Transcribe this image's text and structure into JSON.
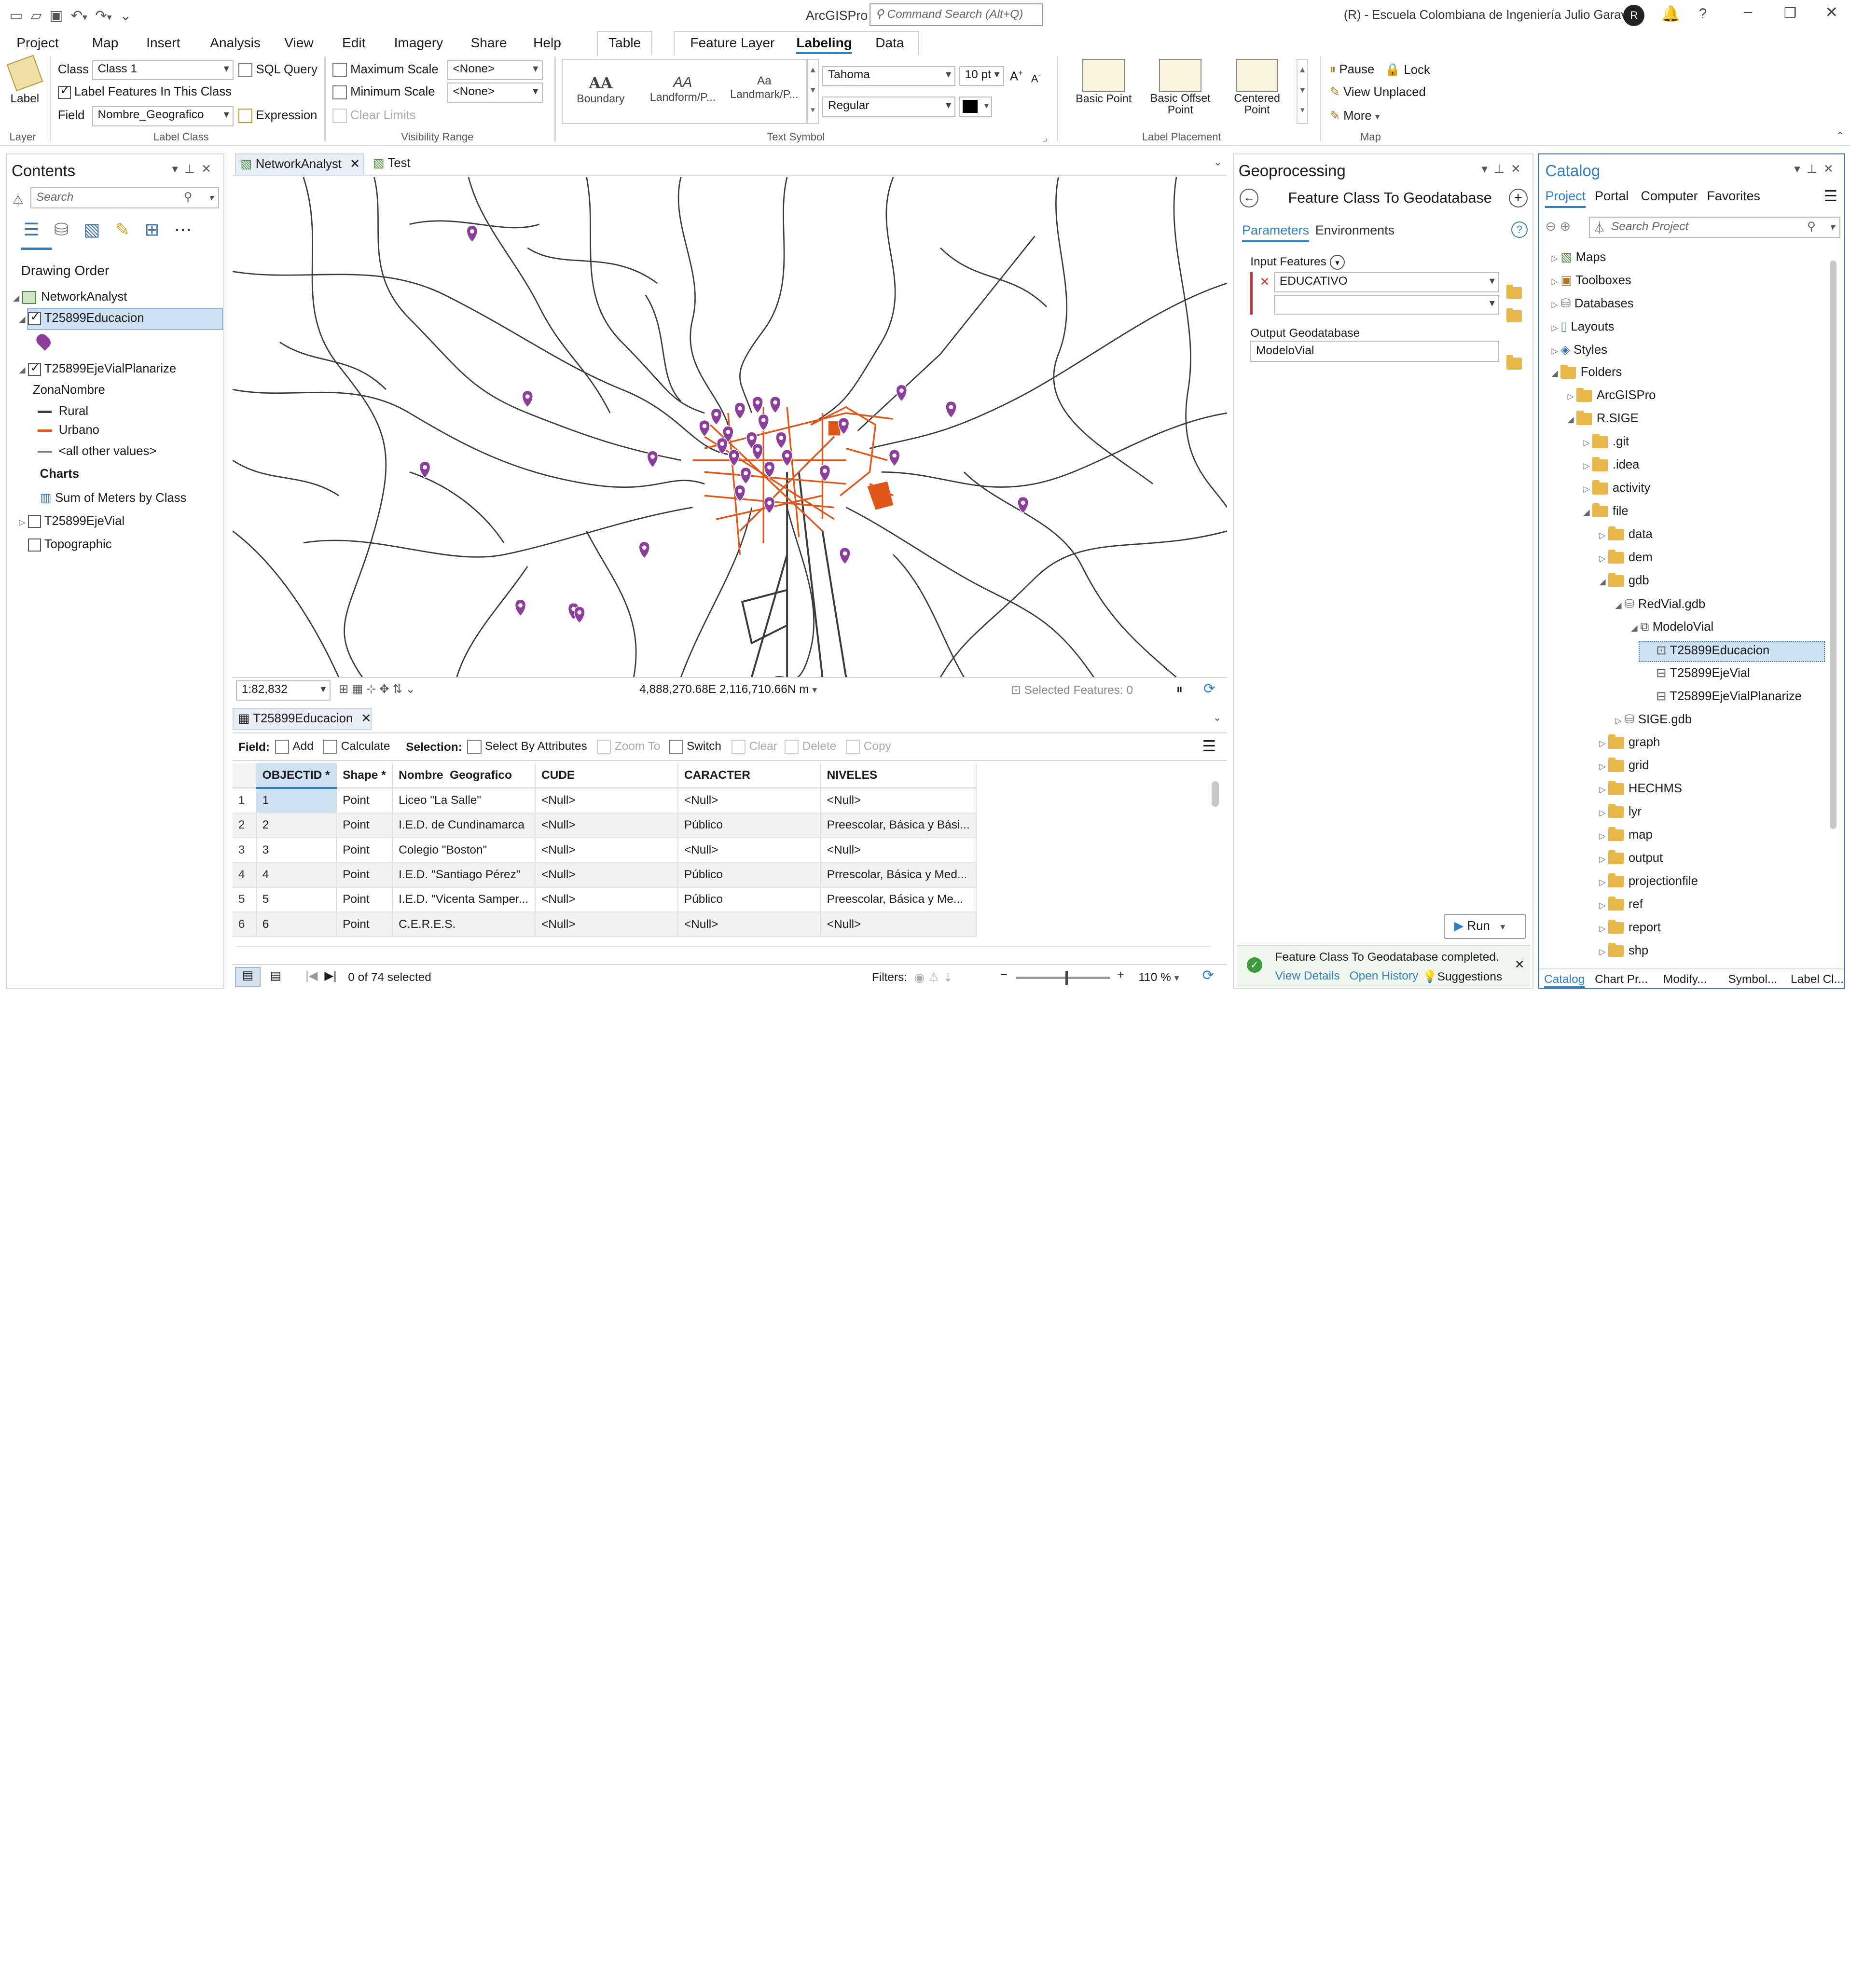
{
  "app": {
    "title": "ArcGISPro",
    "search_placeholder": "Command Search (Alt+Q)",
    "user": "(R) - Escuela Colombiana de Ingeniería Julio Garavito",
    "user_initial": "R"
  },
  "ribbon": {
    "tabs": [
      "Project",
      "Map",
      "Insert",
      "Analysis",
      "View",
      "Edit",
      "Imagery",
      "Share",
      "Help"
    ],
    "context_tabs": {
      "table": "Table",
      "feature_layer": "Feature Layer",
      "labeling": "Labeling",
      "data": "Data"
    },
    "layer_group": {
      "label_btn": "Label",
      "group": "Layer"
    },
    "label_class": {
      "class_lbl": "Class",
      "class_val": "Class 1",
      "sql": "SQL Query",
      "label_features": "Label Features In This Class",
      "field_lbl": "Field",
      "field_val": "Nombre_Geografico",
      "expression": "Expression",
      "group": "Label Class"
    },
    "visibility": {
      "max": "Maximum Scale",
      "min": "Minimum Scale",
      "max_val": "<None>",
      "min_val": "<None>",
      "clear": "Clear Limits",
      "group": "Visibility Range"
    },
    "text_symbol": {
      "s1": "Boundary",
      "s2": "Landform/P...",
      "s3": "Landmark/P...",
      "font": "Tahoma",
      "size": "10 pt",
      "style": "Regular",
      "group": "Text Symbol"
    },
    "placement": {
      "p1": "Basic Point",
      "p2": "Basic Offset Point",
      "p3": "Centered Point",
      "group": "Label Placement"
    },
    "map_group": {
      "pause": "Pause",
      "lock": "Lock",
      "unplaced": "View Unplaced",
      "more": "More",
      "group": "Map"
    }
  },
  "contents": {
    "title": "Contents",
    "search": "Search",
    "drawing_order": "Drawing Order",
    "map": "NetworkAnalyst",
    "layers": {
      "edu": "T25899Educacion",
      "eje_plan": "T25899EjeVialPlanarize",
      "zona": "ZonaNombre",
      "rural": "Rural",
      "urbano": "Urbano",
      "other": "<all other values>",
      "charts": "Charts",
      "sum": "Sum of Meters by Class",
      "eje": "T25899EjeVial",
      "topo": "Topographic"
    }
  },
  "map_view": {
    "tabs": [
      "NetworkAnalyst",
      "Test"
    ],
    "scale": "1:82,832",
    "coords": "4,888,270.68E 2,116,710.66N m",
    "selected": "Selected Features: 0",
    "colors": {
      "urban": "#e0571a",
      "road": "#3a3a3a",
      "poi": "#8b3f9a"
    }
  },
  "table": {
    "tab": "T25899Educacion",
    "field_lbl": "Field:",
    "add": "Add",
    "calculate": "Calculate",
    "selection_lbl": "Selection:",
    "select_by_attr": "Select By Attributes",
    "zoom_to": "Zoom To",
    "switch": "Switch",
    "clear": "Clear",
    "delete": "Delete",
    "copy": "Copy",
    "columns": [
      "OBJECTID *",
      "Shape *",
      "Nombre_Geografico",
      "CUDE",
      "CARACTER",
      "NIVELES"
    ],
    "rows": [
      [
        "1",
        "1",
        "Point",
        "Liceo \"La Salle\"",
        "<Null>",
        "<Null>",
        "<Null>"
      ],
      [
        "2",
        "2",
        "Point",
        "I.E.D. de Cundinamarca",
        "<Null>",
        "Público",
        "Preescolar, Básica y Bási..."
      ],
      [
        "3",
        "3",
        "Point",
        "Colegio \"Boston\"",
        "<Null>",
        "<Null>",
        "<Null>"
      ],
      [
        "4",
        "4",
        "Point",
        "I.E.D. \"Santiago Pérez\"",
        "<Null>",
        "Público",
        "Prrescolar, Básica y Med..."
      ],
      [
        "5",
        "5",
        "Point",
        "I.E.D. \"Vicenta Samper...",
        "<Null>",
        "Público",
        "Preescolar, Básica y Me..."
      ],
      [
        "6",
        "6",
        "Point",
        "C.E.R.E.S.",
        "<Null>",
        "<Null>",
        "<Null>"
      ]
    ],
    "status": "0 of 74 selected",
    "filters": "Filters:",
    "zoom": "110 %"
  },
  "geoprocessing": {
    "title": "Geoprocessing",
    "tool": "Feature Class To Geodatabase",
    "tab_params": "Parameters",
    "tab_env": "Environments",
    "input_lbl": "Input Features",
    "input_val": "EDUCATIVO",
    "output_lbl": "Output Geodatabase",
    "output_val": "ModeloVial",
    "run": "Run",
    "msg": "Feature Class To Geodatabase completed.",
    "view_details": "View Details",
    "open_history": "Open History",
    "suggestions": "Suggestions"
  },
  "catalog": {
    "title": "Catalog",
    "tabs": [
      "Project",
      "Portal",
      "Computer",
      "Favorites"
    ],
    "search": "Search Project",
    "items": [
      "Maps",
      "Toolboxes",
      "Databases",
      "Layouts",
      "Styles",
      "Folders",
      "ArcGISPro",
      "R.SIGE",
      ".git",
      ".idea",
      "activity",
      "file",
      "data",
      "dem",
      "gdb",
      "RedVial.gdb",
      "ModeloVial",
      "T25899Educacion",
      "T25899EjeVial",
      "T25899EjeVialPlanarize",
      "SIGE.gdb",
      "graph",
      "grid",
      "HECHMS",
      "lyr",
      "map",
      "output",
      "projectionfile",
      "ref",
      "report",
      "shp"
    ],
    "bottom_tabs": [
      "Catalog",
      "Chart Pr...",
      "Modify...",
      "Symbol...",
      "Label Cl..."
    ]
  }
}
